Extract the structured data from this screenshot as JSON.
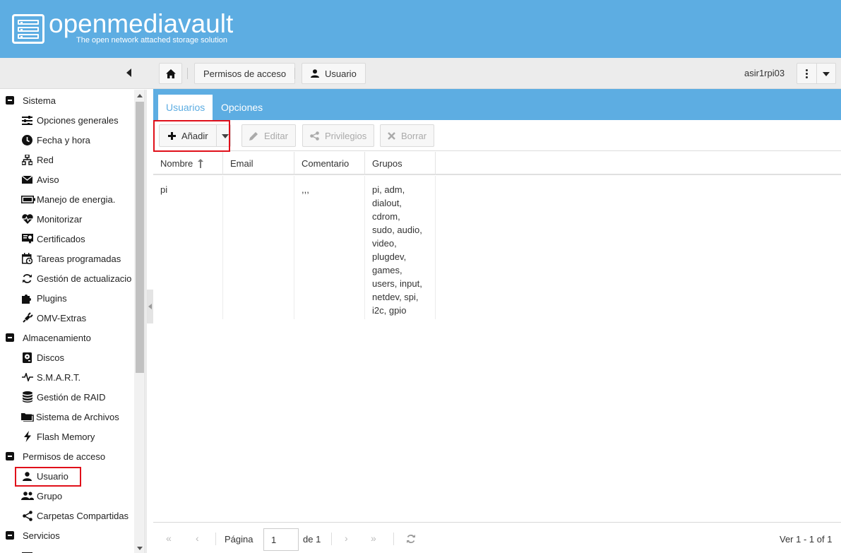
{
  "header": {
    "title": "openmediavault",
    "subtitle": "The open network attached storage solution"
  },
  "topbar": {
    "breadcrumb": [
      "Permisos de acceso",
      "Usuario"
    ],
    "hostname": "asir1rpi03"
  },
  "sidebar": {
    "groups": [
      {
        "label": "Sistema",
        "items": [
          {
            "label": "Opciones generales",
            "icon": "sliders-icon"
          },
          {
            "label": "Fecha y hora",
            "icon": "clock-icon"
          },
          {
            "label": "Red",
            "icon": "network-icon"
          },
          {
            "label": "Aviso",
            "icon": "envelope-icon"
          },
          {
            "label": "Manejo de energia.",
            "icon": "battery-icon"
          },
          {
            "label": "Monitorizar",
            "icon": "heartbeat-icon"
          },
          {
            "label": "Certificados",
            "icon": "certificate-icon"
          },
          {
            "label": "Tareas programadas",
            "icon": "calendar-clock-icon"
          },
          {
            "label": "Gestión de actualizacio",
            "icon": "refresh-icon"
          },
          {
            "label": "Plugins",
            "icon": "puzzle-icon"
          },
          {
            "label": "OMV-Extras",
            "icon": "plug-icon"
          }
        ]
      },
      {
        "label": "Almacenamiento",
        "items": [
          {
            "label": "Discos",
            "icon": "disk-icon"
          },
          {
            "label": "S.M.A.R.T.",
            "icon": "pulse-icon"
          },
          {
            "label": "Gestión de RAID",
            "icon": "database-icon"
          },
          {
            "label": "Sistema de Archivos",
            "icon": "folders-icon"
          },
          {
            "label": "Flash Memory",
            "icon": "flash-icon"
          }
        ]
      },
      {
        "label": "Permisos de acceso",
        "items": [
          {
            "label": "Usuario",
            "icon": "user-icon"
          },
          {
            "label": "Grupo",
            "icon": "users-icon"
          },
          {
            "label": "Carpetas Compartidas",
            "icon": "share-icon"
          }
        ]
      },
      {
        "label": "Servicios",
        "items": []
      }
    ]
  },
  "tabs": [
    {
      "label": "Usuarios",
      "active": true
    },
    {
      "label": "Opciones",
      "active": false
    }
  ],
  "toolbar": {
    "add_label": "Añadir",
    "edit_label": "Editar",
    "privileges_label": "Privilegios",
    "delete_label": "Borrar"
  },
  "grid": {
    "columns": [
      "Nombre",
      "Email",
      "Comentario",
      "Grupos"
    ],
    "rows": [
      {
        "name": "pi",
        "email": "",
        "comment": ",,,",
        "groups_lines": [
          "pi, adm,",
          "dialout,",
          "cdrom,",
          "sudo, audio,",
          "video,",
          "plugdev,",
          "games,",
          "users, input,",
          "netdev, spi,",
          "i2c, gpio"
        ]
      }
    ]
  },
  "pager": {
    "page_label": "Página",
    "page_value": "1",
    "of_label": "de 1",
    "summary": "Ver 1 - 1 of 1"
  },
  "colors": {
    "brand": "#5dade2",
    "highlight": "#e0101a"
  }
}
